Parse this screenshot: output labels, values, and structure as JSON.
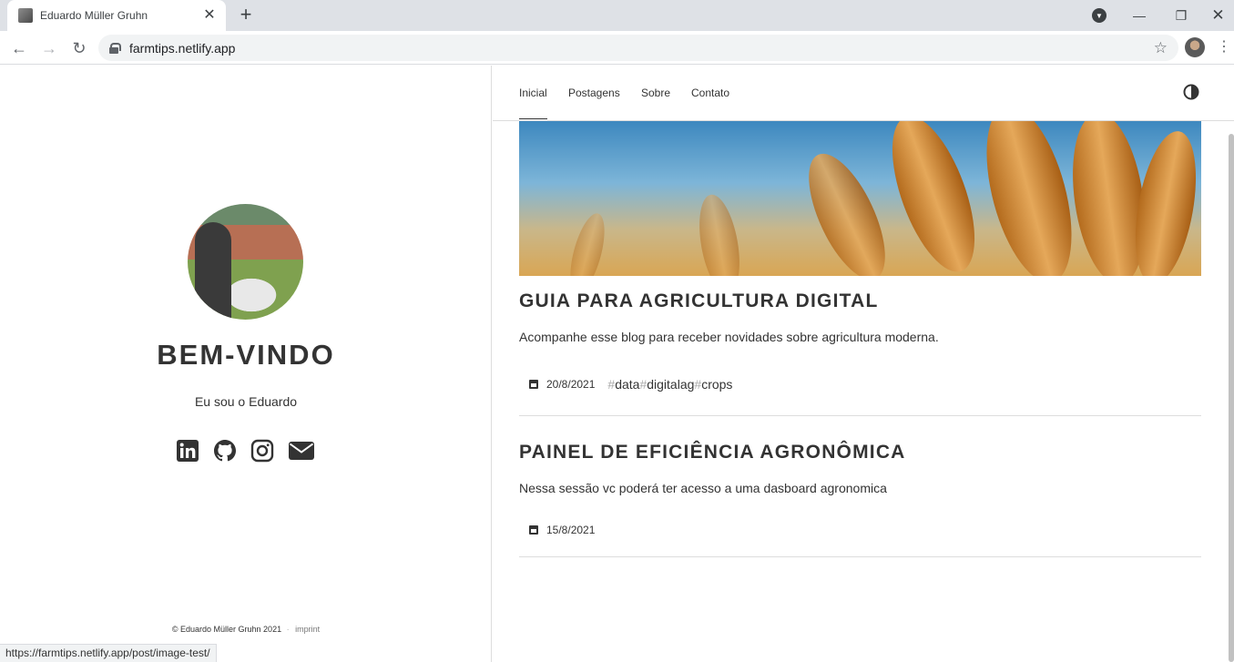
{
  "browser": {
    "tab_title": "Eduardo Müller Gruhn",
    "url": "farmtips.netlify.app",
    "status_url": "https://farmtips.netlify.app/post/image-test/"
  },
  "sidebar": {
    "title": "BEM-VINDO",
    "subtitle": "Eu sou o Eduardo",
    "socials": [
      "linkedin-icon",
      "github-icon",
      "instagram-icon",
      "email-icon"
    ],
    "footer_copyright": "© Eduardo Müller Gruhn 2021",
    "footer_separator": "·",
    "footer_imprint": "imprint"
  },
  "nav": {
    "items": [
      "Inicial",
      "Postagens",
      "Sobre",
      "Contato"
    ],
    "active": "Inicial"
  },
  "posts": [
    {
      "title": "GUIA PARA AGRICULTURA DIGITAL",
      "summary": "Acompanhe esse blog para receber novidades sobre agricultura moderna.",
      "date": "20/8/2021",
      "tags": [
        "data",
        "digitalag",
        "crops"
      ]
    },
    {
      "title": "PAINEL DE EFICIÊNCIA AGRONÔMICA",
      "summary": "Nessa sessão vc poderá ter acesso a uma dasboard agronomica",
      "date": "15/8/2021",
      "tags": []
    }
  ],
  "colors": {
    "text": "#333333",
    "hash": "#aaaaaa",
    "divider": "#dddddd"
  }
}
